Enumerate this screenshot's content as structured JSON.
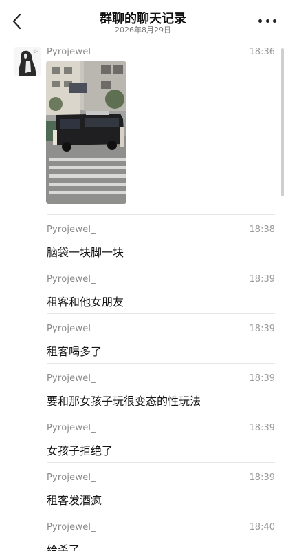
{
  "header": {
    "title": "群聊的聊天记录",
    "subtitle": "2026年8月29日",
    "back_icon": "chevron-left-icon",
    "more_icon": "more-horizontal-icon"
  },
  "messages": [
    {
      "sender": "Pyrojewel_",
      "time": "18:36",
      "type": "image"
    },
    {
      "sender": "Pyrojewel_",
      "time": "18:38",
      "text": "脑袋一块脚一块"
    },
    {
      "sender": "Pyrojewel_",
      "time": "18:39",
      "text": "租客和他女朋友"
    },
    {
      "sender": "Pyrojewel_",
      "time": "18:39",
      "text": "租客喝多了"
    },
    {
      "sender": "Pyrojewel_",
      "time": "18:39",
      "text": "要和那女孩子玩很变态的性玩法"
    },
    {
      "sender": "Pyrojewel_",
      "time": "18:39",
      "text": "女孩子拒绝了"
    },
    {
      "sender": "Pyrojewel_",
      "time": "18:39",
      "text": "租客发酒疯"
    },
    {
      "sender": "Pyrojewel_",
      "time": "18:40",
      "text": "给杀了"
    }
  ],
  "colors": {
    "background": "#ffffff",
    "divider": "#e6e6e6",
    "secondary_text": "#8a8a8a"
  }
}
